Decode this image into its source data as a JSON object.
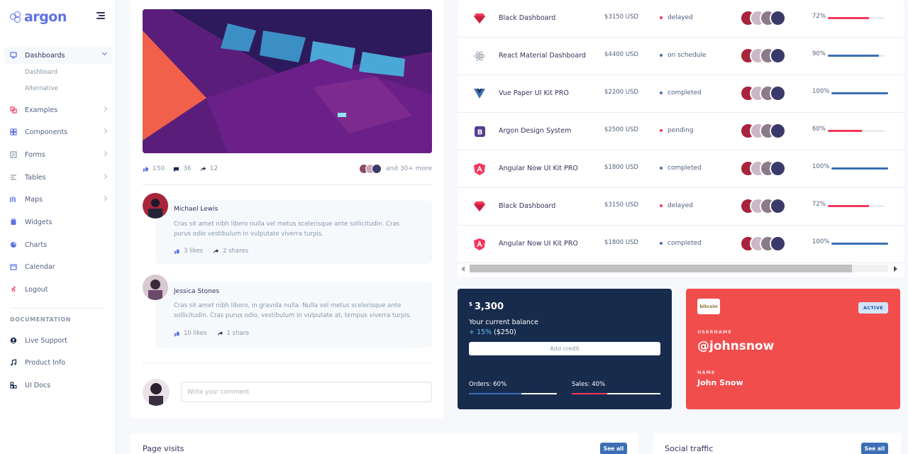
{
  "brand": {
    "name": "argon",
    "accent": "#5e72e4"
  },
  "sidebar": {
    "items": [
      {
        "label": "Dashboards",
        "icon": "monitor-icon",
        "color": "#5e72e4",
        "active": true
      },
      {
        "label": "Examples",
        "icon": "ungroup-icon",
        "color": "#f5365c"
      },
      {
        "label": "Components",
        "icon": "components-icon",
        "color": "#5e72e4"
      },
      {
        "label": "Forms",
        "icon": "forms-icon",
        "color": "#8898aa"
      },
      {
        "label": "Tables",
        "icon": "align-left-icon",
        "color": "#8898aa"
      },
      {
        "label": "Maps",
        "icon": "map-icon",
        "color": "#5e72e4"
      },
      {
        "label": "Widgets",
        "icon": "archive-icon",
        "color": "#5e72e4"
      },
      {
        "label": "Charts",
        "icon": "pie-chart-icon",
        "color": "#5e72e4"
      },
      {
        "label": "Calendar",
        "icon": "calendar-icon",
        "color": "#5e72e4"
      },
      {
        "label": "Logout",
        "icon": "run-icon",
        "color": "#f5365c"
      }
    ],
    "sub_items": [
      {
        "label": "Dashboard"
      },
      {
        "label": "Alternative"
      }
    ],
    "documentation_heading": "DOCUMENTATION",
    "doc_items": [
      {
        "label": "Live Support",
        "icon": "user-icon"
      },
      {
        "label": "Product Info",
        "icon": "music-icon"
      },
      {
        "label": "UI Docs",
        "icon": "docs-icon"
      }
    ]
  },
  "post": {
    "likes": "150",
    "comments": "36",
    "shares": "12",
    "more": "and 30+ more",
    "comments_list": [
      {
        "name": "Michael Lewis",
        "text": "Cras sit amet nibh libero nulla vel metus scelerisque ante sollicitudin. Cras purus odio vestibulum in vulputate viverra turpis.",
        "likes": "3 likes",
        "shares": "2 shares"
      },
      {
        "name": "Jessica Stones",
        "text": "Cras sit amet nibh libero, in gravida nulla. Nulla vel metus scelerisque ante sollicitudin. Cras purus odio, vestibulum in vulputate at, tempus viverra turpis.",
        "likes": "10 likes",
        "shares": "1 share"
      }
    ],
    "comment_placeholder": "Write your comment"
  },
  "projects": {
    "rows": [
      {
        "name": "Black Dashboard",
        "logo": "sketch-icon",
        "budget": "$3150 USD",
        "status": "delayed",
        "status_color": "#f5365c",
        "completion": 72,
        "completion_label": "72%",
        "bar_color": "#f5365c"
      },
      {
        "name": "React Material Dashboard",
        "logo": "react-icon",
        "budget": "$4400 USD",
        "status": "on schedule",
        "status_color": "#3b6fb5",
        "completion": 90,
        "completion_label": "90%",
        "bar_color": "#3b6fb5"
      },
      {
        "name": "Vue Paper UI Kit PRO",
        "logo": "vue-icon",
        "budget": "$2200 USD",
        "status": "completed",
        "status_color": "#3b6fb5",
        "completion": 100,
        "completion_label": "100%",
        "bar_color": "#3b6fb5"
      },
      {
        "name": "Argon Design System",
        "logo": "bootstrap-icon",
        "budget": "$2500 USD",
        "status": "pending",
        "status_color": "#f5365c",
        "completion": 60,
        "completion_label": "60%",
        "bar_color": "#f5365c"
      },
      {
        "name": "Angular Now UI Kit PRO",
        "logo": "angular-icon",
        "budget": "$1800 USD",
        "status": "completed",
        "status_color": "#3b6fb5",
        "completion": 100,
        "completion_label": "100%",
        "bar_color": "#3b6fb5"
      },
      {
        "name": "Black Dashboard",
        "logo": "sketch-icon",
        "budget": "$3150 USD",
        "status": "delayed",
        "status_color": "#f5365c",
        "completion": 72,
        "completion_label": "72%",
        "bar_color": "#f5365c"
      },
      {
        "name": "Angular Now UI Kit PRO",
        "logo": "angular-icon",
        "budget": "$1800 USD",
        "status": "completed",
        "status_color": "#3b6fb5",
        "completion": 100,
        "completion_label": "100%",
        "bar_color": "#3b6fb5"
      }
    ]
  },
  "balance": {
    "currency": "$",
    "amount": "3,300",
    "caption": "Your current balance",
    "delta_pct": "+ 15%",
    "delta_value": "($250)",
    "button": "Add credit",
    "orders_label": "Orders: 60%",
    "orders_pct": 60,
    "sales_label": "Sales: 40%",
    "sales_pct": 40
  },
  "profile": {
    "logo_text": "bitcoin",
    "badge": "ACTIVE",
    "username_label": "USERNAME",
    "username": "@johnsnow",
    "name_label": "NAME",
    "name": "John Snow",
    "bg_color": "#f14d4d"
  },
  "bottom": {
    "page_visits": "Page visits",
    "social_traffic": "Social traffic",
    "see_all": "See all"
  }
}
